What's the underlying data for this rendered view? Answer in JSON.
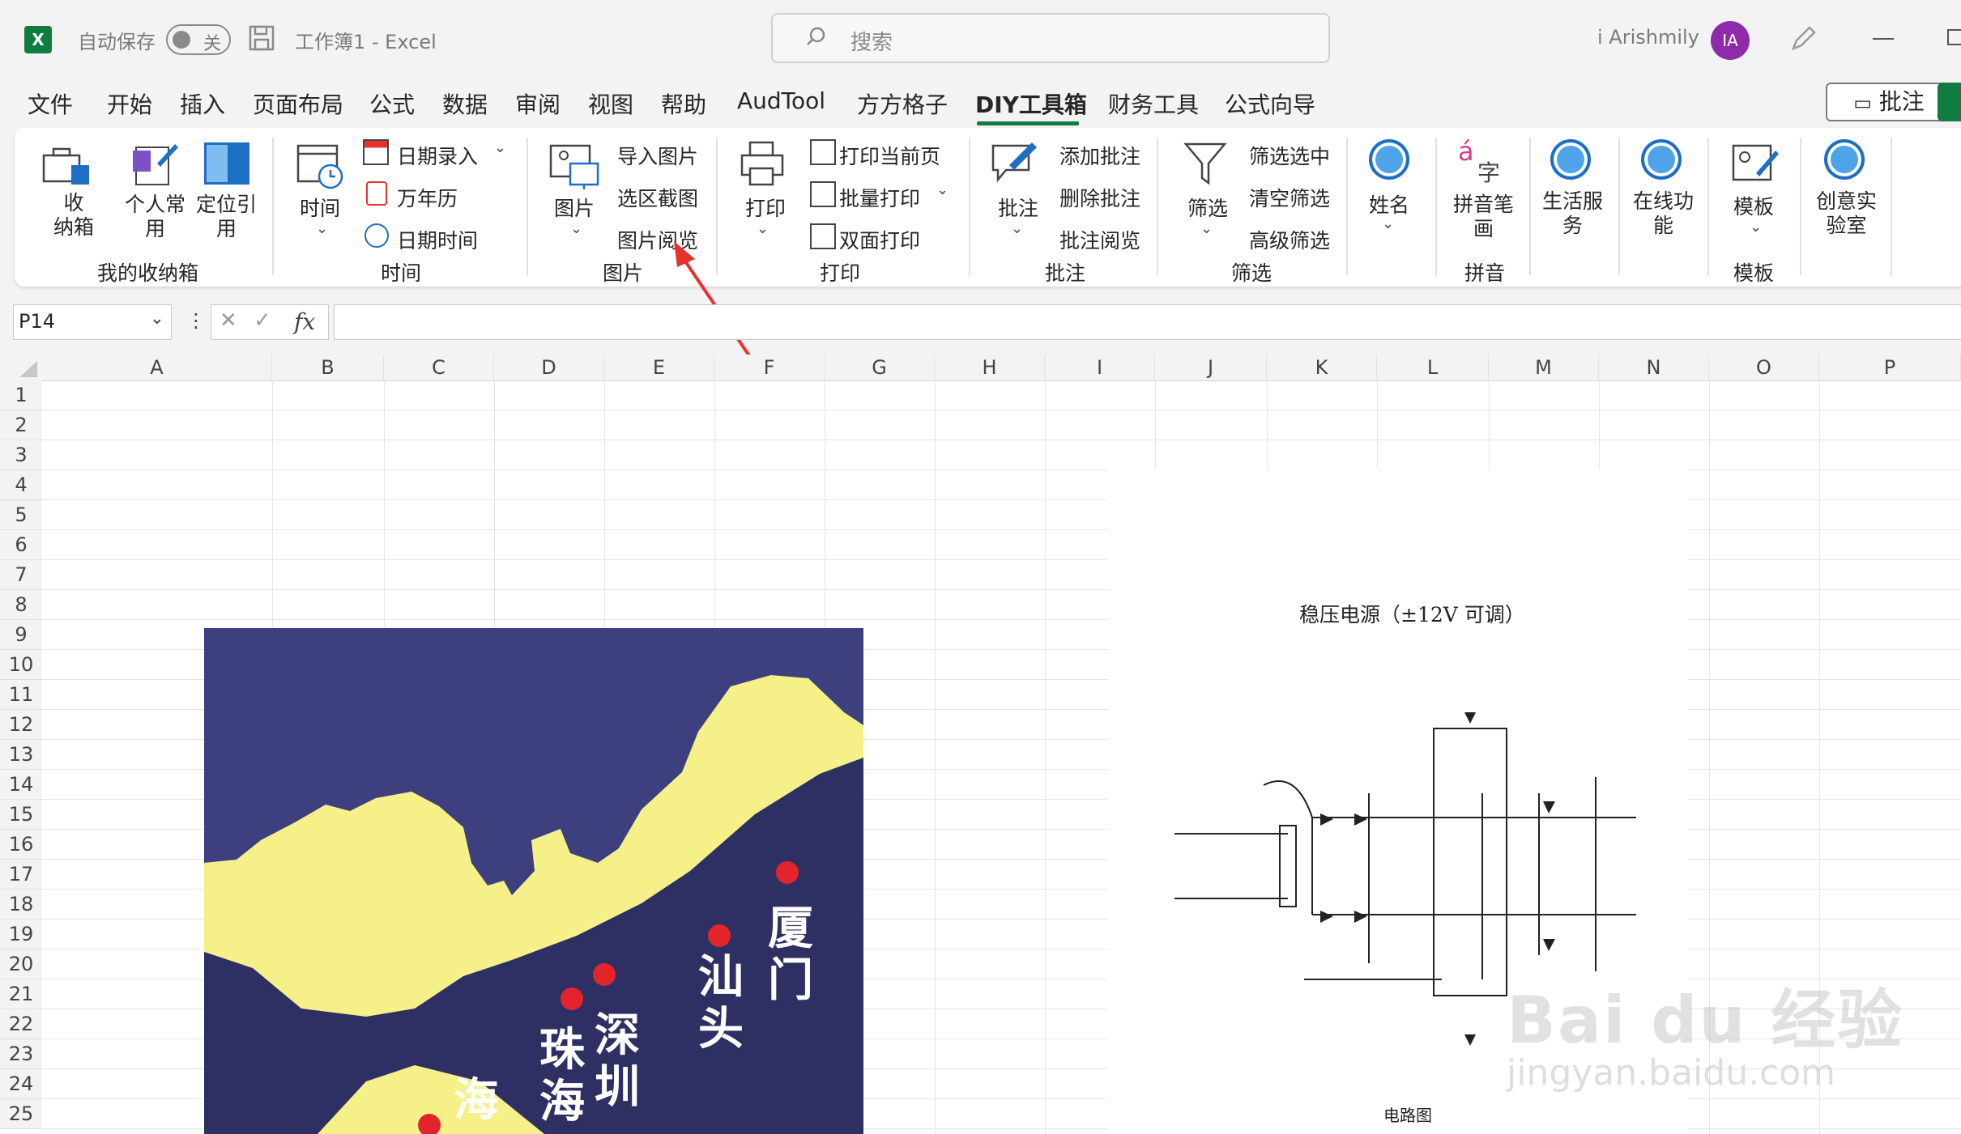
{
  "titlebar": {
    "autosave_label": "自动保存",
    "autosave_state": "关",
    "doc_title": "工作簿1  -  Excel",
    "search_placeholder": "搜索",
    "user_name": "i Arishmily",
    "user_initials": "IA"
  },
  "menu": {
    "tabs": [
      "文件",
      "开始",
      "插入",
      "页面布局",
      "公式",
      "数据",
      "审阅",
      "视图",
      "帮助",
      "AudTool",
      "方方格子",
      "DIY工具箱",
      "财务工具",
      "公式向导"
    ],
    "active_tab": "DIY工具箱",
    "note_button": "批注"
  },
  "ribbon": {
    "groups": [
      {
        "label": "我的收纳箱",
        "items": [
          "收\n纳箱",
          "个人常\n用",
          "定位引\n用"
        ]
      },
      {
        "label": "时间",
        "items": [
          "时间",
          "日期录入",
          "万年历",
          "日期时间"
        ]
      },
      {
        "label": "图片",
        "items": [
          "图片",
          "导入图片",
          "选区截图",
          "图片阅览"
        ]
      },
      {
        "label": "打印",
        "items": [
          "打印",
          "打印当前页",
          "批量打印",
          "双面打印"
        ]
      },
      {
        "label": "批注",
        "items": [
          "批注",
          "添加批注",
          "删除批注",
          "批注阅览"
        ]
      },
      {
        "label": "筛选",
        "items": [
          "筛选",
          "筛选选中",
          "清空筛选",
          "高级筛选"
        ]
      },
      {
        "label": "",
        "items": [
          "姓名"
        ]
      },
      {
        "label": "拼音",
        "items": [
          "拼音笔\n画"
        ]
      },
      {
        "label": "",
        "items": [
          "生活服\n务",
          "在线功\n能"
        ]
      },
      {
        "label": "模板",
        "items": [
          "模板"
        ]
      },
      {
        "label": "",
        "items": [
          "创意实\n验室"
        ]
      }
    ]
  },
  "formula_bar": {
    "name_box": "P14",
    "fx": "fx",
    "formula": ""
  },
  "sheet": {
    "columns": [
      "A",
      "B",
      "C",
      "D",
      "E",
      "F",
      "G",
      "H",
      "I",
      "J",
      "K",
      "L",
      "M",
      "N",
      "O",
      "P"
    ],
    "rows": [
      "1",
      "2",
      "3",
      "4",
      "5",
      "6",
      "7",
      "8",
      "9",
      "10",
      "11",
      "12",
      "13",
      "14",
      "15",
      "16",
      "17",
      "18",
      "19",
      "20",
      "21",
      "22",
      "23",
      "24",
      "25"
    ]
  },
  "map_image": {
    "cities": [
      "厦\n门",
      "汕\n头",
      "深\n圳",
      "珠\n海",
      "海"
    ],
    "sea_color": "#3c3e7e",
    "land_color": "#f5f088",
    "dot_color": "#e3242b"
  },
  "circuit_image": {
    "title": "稳压电源（±12V 可调）",
    "caption": "电路图"
  },
  "watermark": {
    "brand": "Bai du 经验",
    "url": "jingyan.baidu.com"
  },
  "colors": {
    "excel_green": "#107c41",
    "accent_arrow": "#e8322d"
  }
}
